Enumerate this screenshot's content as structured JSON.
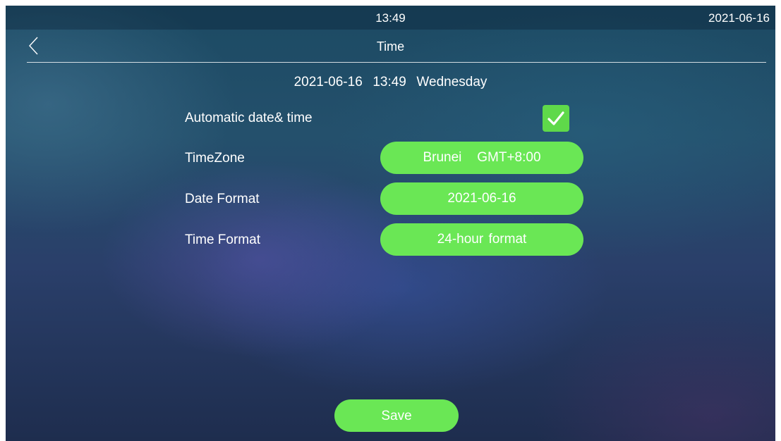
{
  "status_bar": {
    "time": "13:49",
    "date": "2021-06-16"
  },
  "header": {
    "title": "Time",
    "back_icon": "chevron-left-icon"
  },
  "current_datetime": "2021-06-16  13:49  Wednesday",
  "settings": {
    "automatic": {
      "label": "Automatic date& time",
      "checked": true
    },
    "timezone": {
      "label": "TimeZone",
      "value": "Brunei   GMT+8:00"
    },
    "date_format": {
      "label": "Date Format",
      "value": "2021-06-16"
    },
    "time_format": {
      "label": "Time Format",
      "value": "24-hour format"
    }
  },
  "save_label": "Save",
  "colors": {
    "accent": "#6ae755",
    "text": "#ffffff"
  }
}
